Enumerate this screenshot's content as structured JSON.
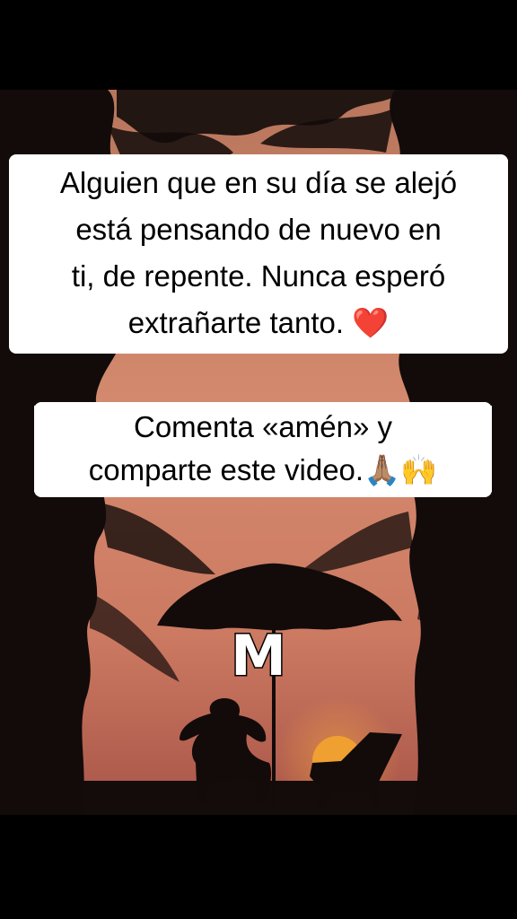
{
  "caption_main": {
    "line1": "Alguien que en su día se alejó",
    "line2": "está pensando de nuevo en",
    "line3": "ti, de repente. Nunca esperó",
    "line4": "extrañarte tanto. ❤️"
  },
  "caption_cta": {
    "line1": "Comenta «amén» y",
    "line2": "comparte este video.🙏🏽🙌"
  },
  "watermark": "M",
  "colors": {
    "sky_top": "#c47a5c",
    "sky_mid": "#d98a6c",
    "sky_low": "#c06a57",
    "sun": "#f0a030",
    "silhouette": "#120b0a"
  }
}
